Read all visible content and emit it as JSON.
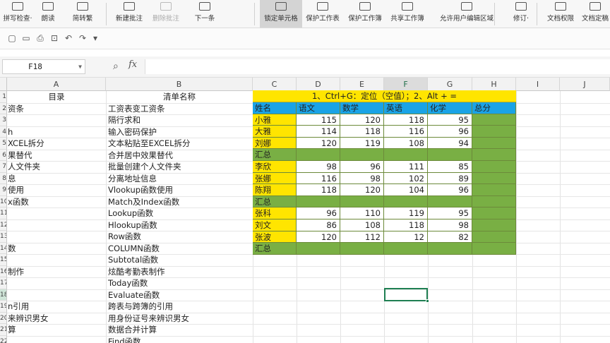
{
  "ribbon": {
    "items": [
      {
        "label": "拼写检查·",
        "icon": "spellcheck-icon"
      },
      {
        "label": "朗读",
        "icon": "read-aloud-icon"
      },
      {
        "label": "简转繁",
        "icon": "convert-icon"
      },
      {
        "label": "新建批注",
        "icon": "new-comment-icon"
      },
      {
        "label": "删除批注",
        "icon": "delete-comment-icon"
      },
      {
        "label": "下一条",
        "icon": "next-comment-icon"
      },
      {
        "label": "锁定单元格",
        "icon": "lock-cell-icon"
      },
      {
        "label": "保护工作表",
        "icon": "protect-sheet-icon"
      },
      {
        "label": "保护工作簿",
        "icon": "protect-workbook-icon"
      },
      {
        "label": "共享工作簿",
        "icon": "share-workbook-icon"
      },
      {
        "label": "允许用户编辑区域",
        "icon": "allow-edit-icon"
      },
      {
        "label": "修订·",
        "icon": "track-changes-icon"
      },
      {
        "label": "文档权限",
        "icon": "doc-permission-icon"
      },
      {
        "label": "文档定稿",
        "icon": "doc-finalize-icon"
      }
    ]
  },
  "formula_bar": {
    "name_box": "F18",
    "fx": "fx",
    "formula": ""
  },
  "columns": [
    "A",
    "B",
    "C",
    "D",
    "E",
    "F",
    "G",
    "H",
    "I",
    "J"
  ],
  "row_numbers": [
    "1",
    "2",
    "3",
    "4",
    "5",
    "6",
    "7",
    "8",
    "9",
    "10",
    "11",
    "12",
    "13",
    "14",
    "15",
    "16",
    "17",
    "18",
    "19",
    "20",
    "21",
    "22"
  ],
  "col_a": [
    "目录",
    "资条",
    "",
    "h",
    "XCEL拆分",
    "果替代",
    "人文件夹",
    "息",
    "使用",
    "x函数",
    "",
    "",
    "",
    "数",
    "",
    "制作",
    "",
    "",
    "n引用",
    "来辨识男女",
    "算",
    ""
  ],
  "col_b": [
    "清单名称",
    "工资表变工资条",
    "隔行求和",
    "输入密码保护",
    "文本粘贴至EXCEL拆分",
    "合并居中效果替代",
    "批量创建个人文件夹",
    "分离地址信息",
    "Vlookup函数使用",
    "Match及Index函数",
    "Lookup函数",
    "Hlookup函数",
    "Row函数",
    "COLUMN函数",
    "Subtotal函数",
    "炫酷考勤表制作",
    "Today函数",
    "Evaluate函数",
    "跨表与跨簿的引用",
    "用身份证号来辨识男女",
    "数据合并计算",
    "Find函数"
  ],
  "table": {
    "title": "1、Ctrl+G：定位（空值）；2、Alt + =",
    "headers": [
      "姓名",
      "语文",
      "数学",
      "英语",
      "化学",
      "总分"
    ],
    "rows": [
      {
        "name": "小雅",
        "v": [
          "115",
          "120",
          "118",
          "95",
          ""
        ]
      },
      {
        "name": "大雅",
        "v": [
          "114",
          "118",
          "116",
          "96",
          ""
        ]
      },
      {
        "name": "刘娜",
        "v": [
          "120",
          "119",
          "108",
          "94",
          ""
        ]
      },
      {
        "name": "汇总",
        "v": [
          "",
          "",
          "",
          "",
          ""
        ],
        "total": true
      },
      {
        "name": "李欣",
        "v": [
          "98",
          "96",
          "111",
          "85",
          ""
        ]
      },
      {
        "name": "张娜",
        "v": [
          "116",
          "98",
          "102",
          "89",
          ""
        ]
      },
      {
        "name": "陈翔",
        "v": [
          "118",
          "120",
          "104",
          "96",
          ""
        ]
      },
      {
        "name": "汇总",
        "v": [
          "",
          "",
          "",
          "",
          ""
        ],
        "total": true
      },
      {
        "name": "张科",
        "v": [
          "96",
          "110",
          "119",
          "95",
          ""
        ]
      },
      {
        "name": "刘文",
        "v": [
          "86",
          "108",
          "118",
          "98",
          ""
        ]
      },
      {
        "name": "张波",
        "v": [
          "120",
          "112",
          "12",
          "82",
          ""
        ]
      },
      {
        "name": "汇总",
        "v": [
          "",
          "",
          "",
          "",
          ""
        ],
        "total": true
      }
    ]
  },
  "colors": {
    "title_yellow": "#ffe500",
    "header_blue": "#1aa3e6",
    "total_green": "#79af44",
    "selection_green": "#1f7f52"
  }
}
